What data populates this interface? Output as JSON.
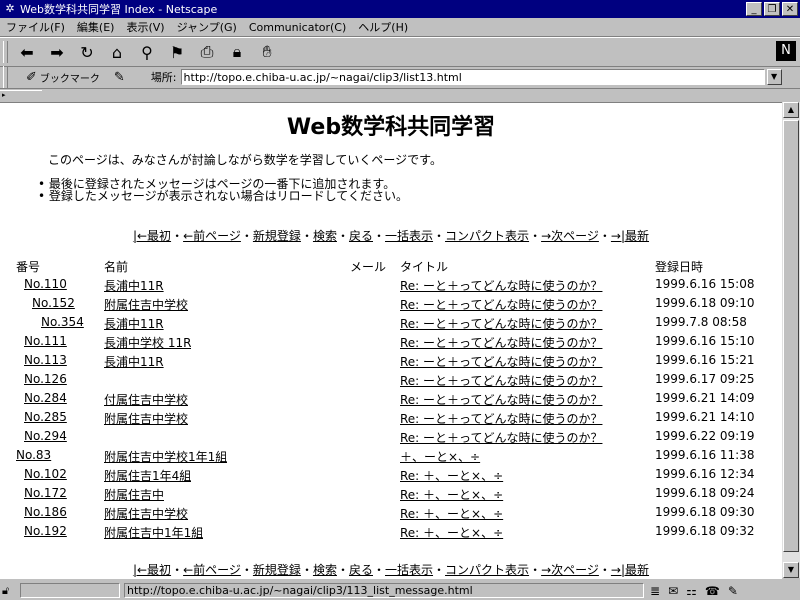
{
  "window": {
    "title": "Web数学科共同学習 Index - Netscape"
  },
  "menu": [
    "ファイル(F)",
    "編集(E)",
    "表示(V)",
    "ジャンプ(G)",
    "Communicator(C)",
    "ヘルプ(H)"
  ],
  "location": {
    "bookmarks_label": "ブックマーク",
    "label": "場所:",
    "url": "http://topo.e.chiba-u.ac.jp/~nagai/clip3/list13.html"
  },
  "page": {
    "title": "Web数学科共同学習",
    "intro": "このページは、みなさんが討論しながら数学を学習していくページです。",
    "bullets": [
      "最後に登録されたメッセージはページの一番下に追加されます。",
      "登録したメッセージが表示されない場合はリロードしてください。"
    ],
    "nav": [
      "|←最初",
      "←前ページ",
      "新規登録",
      "検索",
      "戻る",
      "一括表示",
      "コンパクト表示",
      "→次ページ",
      "→|最新"
    ],
    "nav_sep": "・",
    "headers": {
      "num": "番号",
      "name": "名前",
      "mail": "メール",
      "subject": "タイトル",
      "date": "登録日時"
    },
    "rows": [
      {
        "num": "No.110",
        "name": "長浦中11R",
        "subject": "Re: ーと＋ってどんな時に使うのか？",
        "date": "1999.6.16 15:08"
      },
      {
        "num": "No.152",
        "name": "附属住吉中学校",
        "subject": "Re: ーと＋ってどんな時に使うのか？",
        "date": "1999.6.18 09:10"
      },
      {
        "num": "No.354",
        "name": "長浦中11R",
        "subject": "Re: ーと＋ってどんな時に使うのか？",
        "date": "1999.7.8 08:58"
      },
      {
        "num": "No.111",
        "name": "長浦中学校 11R",
        "subject": "Re: ーと＋ってどんな時に使うのか？",
        "date": "1999.6.16 15:10"
      },
      {
        "num": "No.113",
        "name": "長浦中11R",
        "subject": "Re: ーと＋ってどんな時に使うのか？",
        "date": "1999.6.16 15:21"
      },
      {
        "num": "No.126",
        "name": "",
        "subject": "Re: ーと＋ってどんな時に使うのか？",
        "date": "1999.6.17 09:25"
      },
      {
        "num": "No.284",
        "name": "付属住吉中学校",
        "subject": "Re: ーと＋ってどんな時に使うのか？",
        "date": "1999.6.21 14:09"
      },
      {
        "num": "No.285",
        "name": "附属住吉中学校",
        "subject": "Re: ーと＋ってどんな時に使うのか？",
        "date": "1999.6.21 14:10"
      },
      {
        "num": "No.294",
        "name": "",
        "subject": "Re: ーと＋ってどんな時に使うのか？",
        "date": "1999.6.22 09:19"
      },
      {
        "num": "No.83",
        "name": "附属住吉中学校1年1組",
        "subject": "＋、ーと×、÷",
        "date": "1999.6.16 11:38"
      },
      {
        "num": "No.102",
        "name": "附属住吉1年4組",
        "subject": "Re: ＋、ーと×、÷",
        "date": "1999.6.16 12:34"
      },
      {
        "num": "No.172",
        "name": "附属住吉中",
        "subject": "Re: ＋、ーと×、÷",
        "date": "1999.6.18 09:24"
      },
      {
        "num": "No.186",
        "name": "附属住吉中学校",
        "subject": "Re: ＋、ーと×、÷",
        "date": "1999.6.18 09:30"
      },
      {
        "num": "No.192",
        "name": "附属住吉中1年1組",
        "subject": "Re: ＋、ーと×、÷",
        "date": "1999.6.18 09:32"
      }
    ]
  },
  "status": {
    "message": "http://topo.e.chiba-u.ac.jp/~nagai/clip3/113_list_message.html"
  }
}
